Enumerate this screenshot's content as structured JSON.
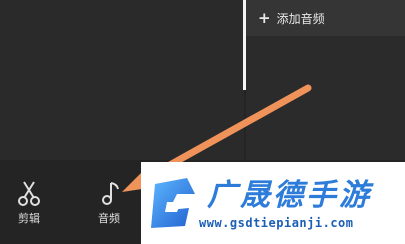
{
  "timeline": {
    "add_audio_label": "添加音频"
  },
  "toolbar": {
    "cut_label": "剪辑",
    "audio_label": "音频"
  },
  "watermark": {
    "name": "广晟德手游",
    "url": "www.gsdtiepianji.com"
  },
  "colors": {
    "background": "#242424",
    "arrow": "#f0935a",
    "brand_blue": "#2e7cd9"
  },
  "icons": [
    "plus-icon",
    "scissors-icon",
    "music-note-icon"
  ]
}
